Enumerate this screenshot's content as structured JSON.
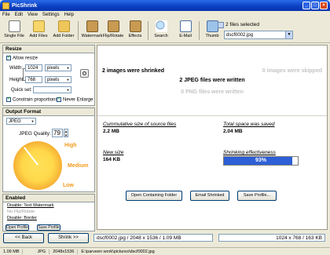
{
  "window": {
    "title": "PicShrink"
  },
  "menu": [
    "File",
    "Edit",
    "View",
    "Settings",
    "Help"
  ],
  "toolbar": {
    "single_file": "Single File",
    "add_files": "Add Files",
    "add_folder": "Add Folder",
    "watermark": "Watermark",
    "flip_rotate": "Flip/Rotate",
    "effects": "Effects",
    "search": "Search",
    "email": "E-Mail",
    "thumb": "Thumb",
    "files_selected": "2 files selected",
    "file_selected": "dscf0002.jpg"
  },
  "resize": {
    "header": "Resize",
    "allow_resize": "Allow resize",
    "width_label": "Width:",
    "width_value": "1024",
    "height_label": "Height:",
    "height_value": "768",
    "unit": "pixels",
    "quick_set_label": "Quick set:",
    "constrain": "Constrain proportions",
    "never_enlarge": "Never Enlarge"
  },
  "output": {
    "header": "Output Format",
    "format": "JPEG",
    "quality_label": "JPEG Quality:",
    "quality_value": "79",
    "quality_fraction": 0.79,
    "high": "High",
    "medium": "Medium",
    "low": "Low"
  },
  "enabled": {
    "header": "Enabled",
    "watermark_link": "Disable: Text Watermark",
    "flip_rotate": "No Flip/Rotate",
    "border_link": "Disable: Border",
    "btn1": "Open Profile",
    "btn2": "Save Profile"
  },
  "nav": {
    "back": "<< Back",
    "shrink": "Shrink >>"
  },
  "results": {
    "shrinked": "2 images were shrinked",
    "skipped": "0 images were skipped",
    "jpeg_written": "2 JPEG files were written",
    "png_written": "0 PNG files were written",
    "cum_label": "Cummulative size of source files",
    "cum_value": "2.2 MB",
    "saved_label": "Total space was saved",
    "saved_value": "2.04 MB",
    "new_label": "New size",
    "new_value": "164 KB",
    "eff_label": "Shrinking effectiveness",
    "eff_value": "93%",
    "eff_fraction": 0.93
  },
  "actions": {
    "open_folder": "Open Containing Folder",
    "email": "Email Shrinked",
    "save_profile": "Save Profile..."
  },
  "infobar": {
    "left": "dscf0002.jpg  /  2048 x 1536  /  1.09 MB",
    "right": "1024 x 768  /  163 KB"
  },
  "statusbar": {
    "size": "1.09 MB",
    "format": "JPG",
    "dims": "2048x1536",
    "path": "E:\\parveen work\\pictures\\dscf0002.jpg"
  },
  "colors": {
    "accent": "#2a6bea",
    "progress": "#2d5fd6",
    "dial_center": "#ffd84a",
    "dial_edge": "#f08a1a"
  }
}
